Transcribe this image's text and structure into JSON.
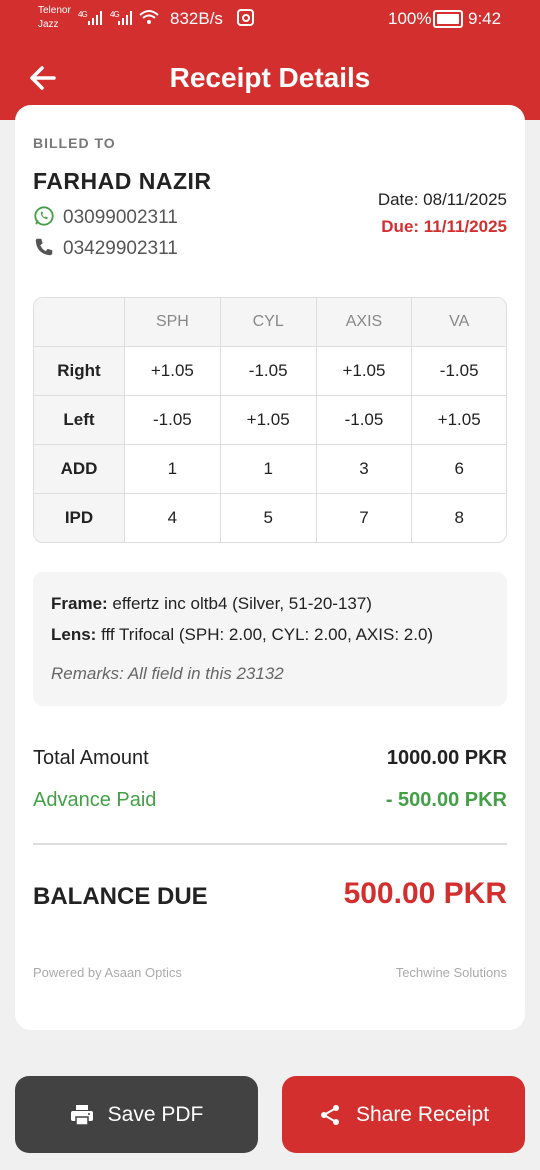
{
  "status": {
    "carrier_line1": "Telenor",
    "carrier_line2": "Jazz",
    "signal1": "4G",
    "signal2": "4G",
    "speed": "832B/s",
    "battery": "100%",
    "time": "9:42"
  },
  "header": {
    "title": "Receipt Details"
  },
  "customer": {
    "billed_to_label": "BILLED TO",
    "name": "FARHAD NAZIR",
    "whatsapp": "03099002311",
    "phone": "03429902311"
  },
  "dates": {
    "date": "Date: 08/11/2025",
    "due": "Due: 11/11/2025"
  },
  "prescription": {
    "columns": [
      "",
      "SPH",
      "CYL",
      "AXIS",
      "VA"
    ],
    "rows": [
      {
        "label": "Right",
        "values": [
          "+1.05",
          "-1.05",
          "+1.05",
          "-1.05"
        ]
      },
      {
        "label": "Left",
        "values": [
          "-1.05",
          "+1.05",
          "-1.05",
          "+1.05"
        ]
      },
      {
        "label": "ADD",
        "values": [
          "1",
          "1",
          "3",
          "6"
        ]
      },
      {
        "label": "IPD",
        "values": [
          "4",
          "5",
          "7",
          "8"
        ]
      }
    ]
  },
  "details": {
    "frame_label": "Frame:",
    "frame_value": "effertz inc oltb4 (Silver, 51-20-137)",
    "lens_label": "Lens:",
    "lens_value": "fff Trifocal (SPH: 2.00, CYL: 2.00, AXIS: 2.0)",
    "remarks": "Remarks: All field in this 23132"
  },
  "totals": {
    "total_label": "Total Amount",
    "total_value": "1000.00 PKR",
    "advance_label": "Advance Paid",
    "advance_value": "- 500.00 PKR",
    "balance_label": "BALANCE DUE",
    "balance_value": "500.00 PKR"
  },
  "footer": {
    "left": "Powered by Asaan Optics",
    "right": "Techwine Solutions"
  },
  "actions": {
    "save_pdf": "Save PDF",
    "share": "Share Receipt"
  },
  "colors": {
    "brand": "#d32f2f",
    "success": "#43a047",
    "dark_button": "#424242"
  }
}
